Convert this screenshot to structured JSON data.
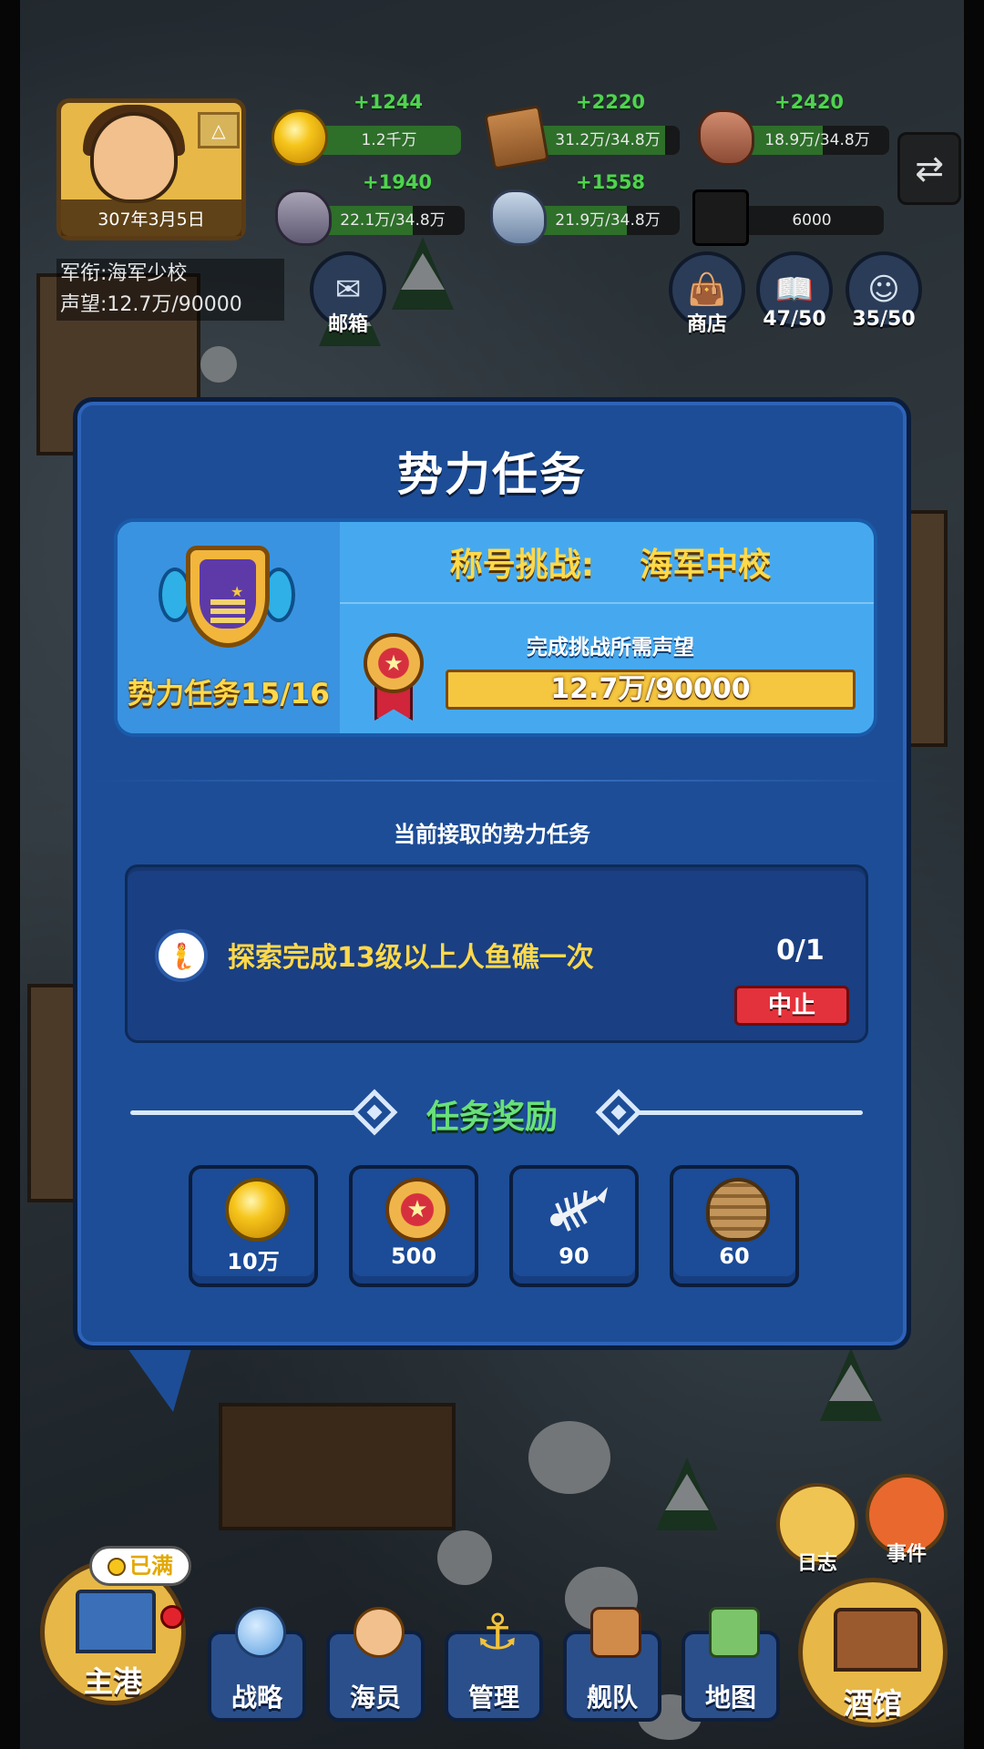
{
  "hud": {
    "date": "307年3月5日",
    "rank": "军衔:海军少校",
    "reputation": "声望:12.7万/90000",
    "resources": [
      {
        "name": "gold",
        "icon": "gold-coin-icon",
        "gain": "+1244",
        "amount": "1.2千万",
        "fill": 1.0
      },
      {
        "name": "wood",
        "icon": "wood-icon",
        "gain": "+2220",
        "amount": "31.2万/34.8万",
        "fill": 0.9
      },
      {
        "name": "stone",
        "icon": "stone-icon",
        "gain": "+2420",
        "amount": "18.9万/34.8万",
        "fill": 0.54
      },
      {
        "name": "iron",
        "icon": "iron-ore-icon",
        "gain": "+1940",
        "amount": "22.1万/34.8万",
        "fill": 0.64
      },
      {
        "name": "crystal",
        "icon": "crystal-icon",
        "gain": "+1558",
        "amount": "21.9万/34.8万",
        "fill": 0.63
      },
      {
        "name": "education",
        "icon": "graduation-cap-icon",
        "gain": "",
        "amount": "6000",
        "fill": 0.0
      }
    ],
    "mail_label": "邮箱",
    "shop_label": "商店",
    "book_label": "47/50",
    "crew_label": "35/50"
  },
  "modal": {
    "title": "势力任务",
    "task_count": "势力任务15/16",
    "challenge_label": "称号挑战:",
    "challenge_target": "海军中校",
    "requirement_label": "完成挑战所需声望",
    "reputation_progress": "12.7万/90000",
    "reputation_fill": 1.0,
    "current_label": "当前接取的势力任务",
    "task": {
      "text": "探索完成13级以上人鱼礁一次",
      "progress": "0/1",
      "abort_label": "中止"
    },
    "reward_title": "任务奖励",
    "rewards": [
      {
        "icon": "gold-coin-icon",
        "qty": "10万"
      },
      {
        "icon": "medal-icon",
        "qty": "500"
      },
      {
        "icon": "fish-bone-icon",
        "qty": "90"
      },
      {
        "icon": "rope-coil-icon",
        "qty": "60"
      }
    ]
  },
  "bottom": {
    "full_label": "已满",
    "port_label": "主港",
    "log_label": "日志",
    "event_label": "事件",
    "nav": [
      {
        "key": "strategy",
        "label": "战略"
      },
      {
        "key": "crew",
        "label": "海员"
      },
      {
        "key": "manage",
        "label": "管理"
      },
      {
        "key": "fleet",
        "label": "舰队"
      },
      {
        "key": "map",
        "label": "地图"
      }
    ],
    "tavern_label": "酒馆"
  }
}
